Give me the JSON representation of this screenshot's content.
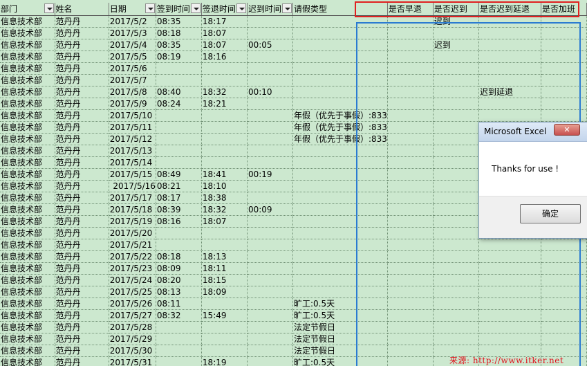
{
  "headers": [
    "部门",
    "姓名",
    "日期",
    "签到时间",
    "签退时间",
    "迟到时间",
    "请假类型",
    "是否早退",
    "是否迟到",
    "是否迟到延退",
    "是否加班"
  ],
  "rows": [
    [
      "信息技术部",
      "范丹丹",
      "2017/5/2",
      "08:35",
      "18:17",
      "",
      "",
      "",
      "迟到",
      "",
      ""
    ],
    [
      "信息技术部",
      "范丹丹",
      "2017/5/3",
      "08:18",
      "18:07",
      "",
      "",
      "",
      "",
      "",
      ""
    ],
    [
      "信息技术部",
      "范丹丹",
      "2017/5/4",
      "08:35",
      "18:07",
      "00:05",
      "",
      "",
      "迟到",
      "",
      ""
    ],
    [
      "信息技术部",
      "范丹丹",
      "2017/5/5",
      "08:19",
      "18:16",
      "",
      "",
      "",
      "",
      "",
      ""
    ],
    [
      "信息技术部",
      "范丹丹",
      "2017/5/6",
      "",
      "",
      "",
      "",
      "",
      "",
      "",
      ""
    ],
    [
      "信息技术部",
      "范丹丹",
      "2017/5/7",
      "",
      "",
      "",
      "",
      "",
      "",
      "",
      ""
    ],
    [
      "信息技术部",
      "范丹丹",
      "2017/5/8",
      "08:40",
      "18:32",
      "00:10",
      "",
      "",
      "",
      "迟到延退",
      ""
    ],
    [
      "信息技术部",
      "范丹丹",
      "2017/5/9",
      "08:24",
      "18:21",
      "",
      "",
      "",
      "",
      "",
      ""
    ],
    [
      "信息技术部",
      "范丹丹",
      "2017/5/10",
      "",
      "",
      "",
      "年假（优先于事假）:833",
      "",
      "",
      "",
      ""
    ],
    [
      "信息技术部",
      "范丹丹",
      "2017/5/11",
      "",
      "",
      "",
      "年假（优先于事假）:833",
      "",
      "",
      "",
      ""
    ],
    [
      "信息技术部",
      "范丹丹",
      "2017/5/12",
      "",
      "",
      "",
      "年假（优先于事假）:833",
      "",
      "",
      "",
      ""
    ],
    [
      "信息技术部",
      "范丹丹",
      "2017/5/13",
      "",
      "",
      "",
      "",
      "",
      "",
      "",
      ""
    ],
    [
      "信息技术部",
      "范丹丹",
      "2017/5/14",
      "",
      "",
      "",
      "",
      "",
      "",
      "",
      ""
    ],
    [
      "信息技术部",
      "范丹丹",
      "2017/5/15",
      "08:49",
      "18:41",
      "00:19",
      "",
      "",
      "",
      "",
      ""
    ],
    [
      "信息技术部",
      "范丹丹",
      "2017/5/16",
      "08:21",
      "18:10",
      "",
      "",
      "",
      "",
      "",
      ""
    ],
    [
      "信息技术部",
      "范丹丹",
      "2017/5/17",
      "08:17",
      "18:38",
      "",
      "",
      "",
      "",
      "",
      ""
    ],
    [
      "信息技术部",
      "范丹丹",
      "2017/5/18",
      "08:39",
      "18:32",
      "00:09",
      "",
      "",
      "",
      "",
      ""
    ],
    [
      "信息技术部",
      "范丹丹",
      "2017/5/19",
      "08:16",
      "18:07",
      "",
      "",
      "",
      "",
      "",
      ""
    ],
    [
      "信息技术部",
      "范丹丹",
      "2017/5/20",
      "",
      "",
      "",
      "",
      "",
      "",
      "",
      ""
    ],
    [
      "信息技术部",
      "范丹丹",
      "2017/5/21",
      "",
      "",
      "",
      "",
      "",
      "",
      "",
      ""
    ],
    [
      "信息技术部",
      "范丹丹",
      "2017/5/22",
      "08:18",
      "18:13",
      "",
      "",
      "",
      "",
      "",
      ""
    ],
    [
      "信息技术部",
      "范丹丹",
      "2017/5/23",
      "08:09",
      "18:11",
      "",
      "",
      "",
      "",
      "",
      ""
    ],
    [
      "信息技术部",
      "范丹丹",
      "2017/5/24",
      "08:20",
      "18:15",
      "",
      "",
      "",
      "",
      "",
      ""
    ],
    [
      "信息技术部",
      "范丹丹",
      "2017/5/25",
      "08:13",
      "18:09",
      "",
      "",
      "",
      "",
      "",
      ""
    ],
    [
      "信息技术部",
      "范丹丹",
      "2017/5/26",
      "08:11",
      "",
      "",
      "旷工:0.5天",
      "",
      "",
      "",
      ""
    ],
    [
      "信息技术部",
      "范丹丹",
      "2017/5/27",
      "08:32",
      "15:49",
      "",
      "旷工:0.5天",
      "",
      "",
      "",
      ""
    ],
    [
      "信息技术部",
      "范丹丹",
      "2017/5/28",
      "",
      "",
      "",
      "法定节假日",
      "",
      "",
      "",
      ""
    ],
    [
      "信息技术部",
      "范丹丹",
      "2017/5/29",
      "",
      "",
      "",
      "法定节假日",
      "",
      "",
      "",
      ""
    ],
    [
      "信息技术部",
      "范丹丹",
      "2017/5/30",
      "",
      "",
      "",
      "法定节假日",
      "",
      "",
      "",
      ""
    ],
    [
      "信息技术部",
      "范丹丹",
      "2017/5/31",
      "",
      "18:19",
      "",
      "旷工:0.5天",
      "",
      "",
      "",
      ""
    ]
  ],
  "dialog": {
    "title": "Microsoft Excel",
    "close_label": "✕",
    "message": "Thanks for use !",
    "ok_label": "确定"
  },
  "watermark": "来源: http://www.itker.net"
}
